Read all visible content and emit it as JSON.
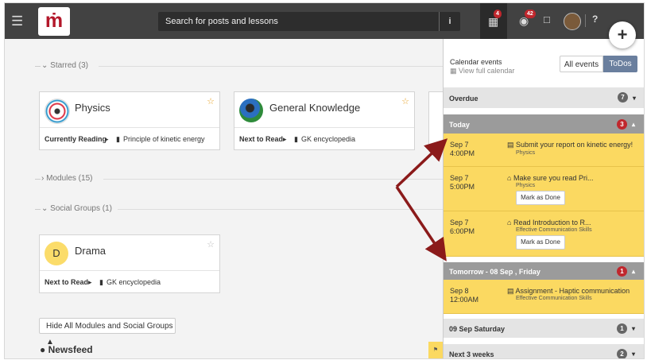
{
  "topbar": {
    "logo_text": "ṁ",
    "search_placeholder": "Search for posts and lessons",
    "calendar_badge": "4",
    "notifications_badge": "42"
  },
  "sections": {
    "starred": "Starred (3)",
    "modules": "Modules (15)",
    "social_groups": "Social Groups (1)"
  },
  "cards": [
    {
      "name": "Physics",
      "foot_label": "Currently Reading",
      "foot_item": "Principle of kinetic energy"
    },
    {
      "name": "General Knowledge",
      "foot_label": "Next to Read",
      "foot_item": "GK encyclopedia"
    },
    {
      "name": "Drama",
      "initial": "D",
      "foot_label": "Next to Read",
      "foot_item": "GK encyclopedia"
    }
  ],
  "hide_button": "Hide All Modules and Social Groups",
  "newsfeed": "Newsfeed",
  "panel": {
    "title": "Calendar events",
    "view_link": "View full calendar",
    "toggle_all": "All events",
    "toggle_todos": "ToDos",
    "overdue": {
      "label": "Overdue",
      "count": "7"
    },
    "today": {
      "label": "Today",
      "count": "3"
    },
    "tomorrow": {
      "label": "Tomorrow - 08 Sep , Friday",
      "count": "1"
    },
    "saturday": {
      "label": "09 Sep Saturday",
      "count": "1"
    },
    "next3": {
      "label": "Next 3 weeks",
      "count": "2"
    },
    "mark_done": "Mark as Done",
    "events": [
      {
        "date": "Sep 7",
        "time": "4:00PM",
        "title": "Submit your report on kinetic energy!",
        "sub": "Physics"
      },
      {
        "date": "Sep 7",
        "time": "5:00PM",
        "title": "Make sure you read Pri...",
        "sub": "Physics"
      },
      {
        "date": "Sep 7",
        "time": "6:00PM",
        "title": "Read Introduction to R...",
        "sub": "Effective Communication Skills"
      },
      {
        "date": "Sep 8",
        "time": "12:00AM",
        "title": "Assignment - Haptic communication",
        "sub": "Effective Communication Skills"
      }
    ]
  },
  "colors": {
    "brand": "#b3172a",
    "todo_yellow": "#fbd961",
    "arrow": "#8b1a1a"
  }
}
